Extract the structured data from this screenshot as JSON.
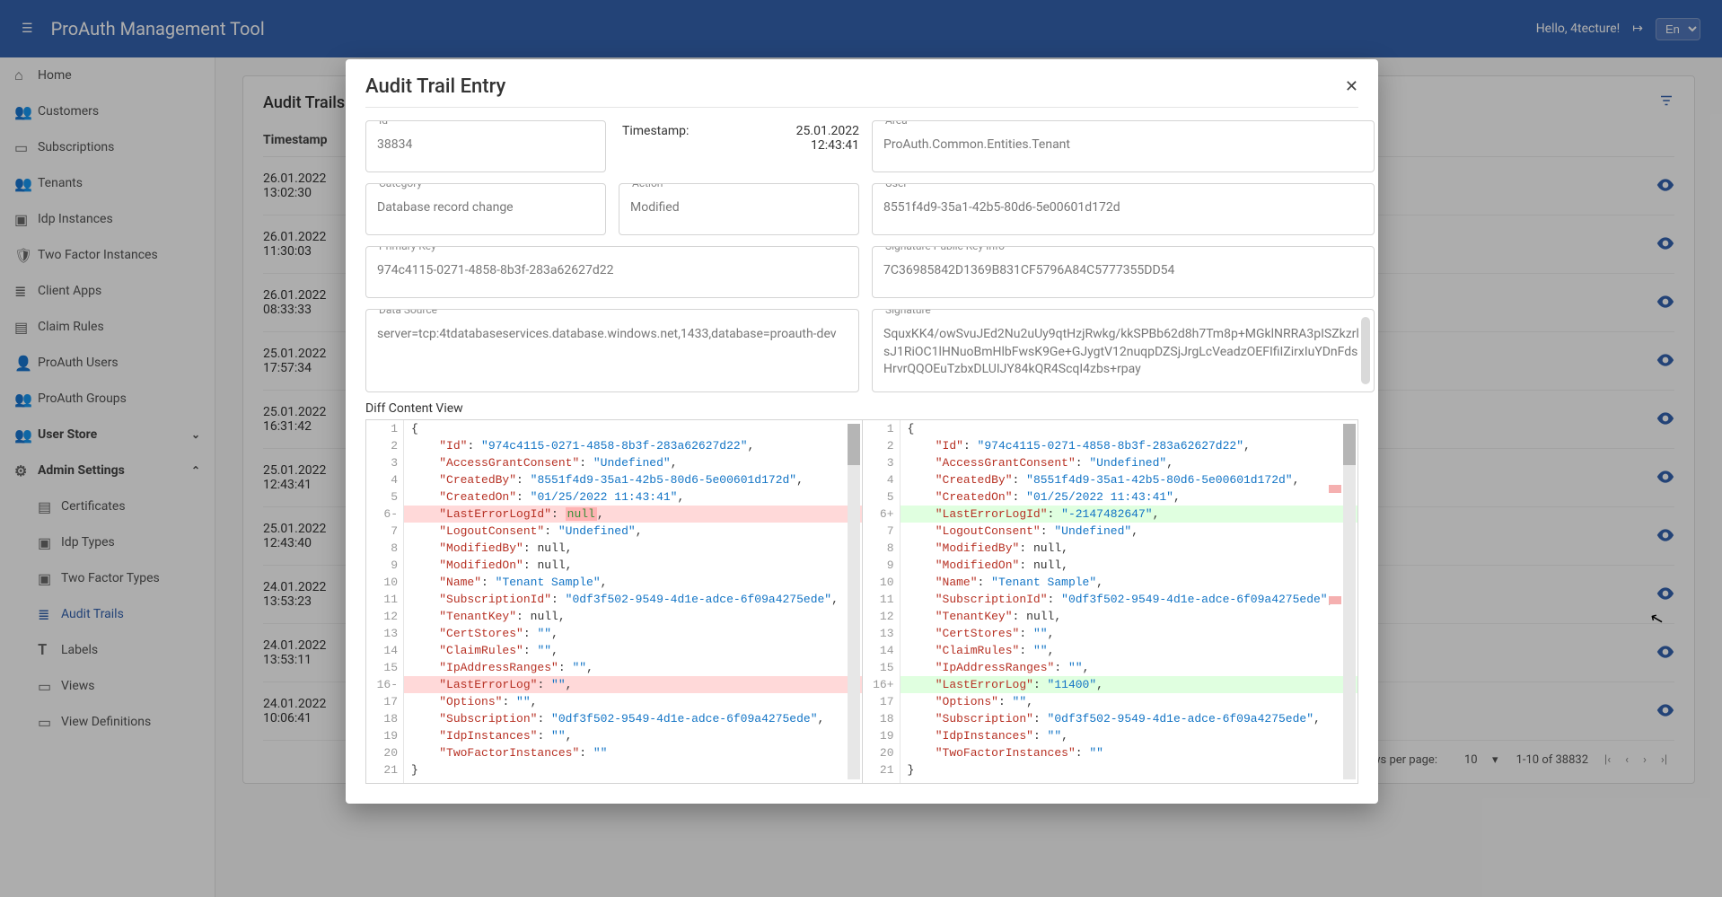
{
  "header": {
    "title": "ProAuth Management Tool",
    "greeting": "Hello, 4tecture!",
    "lang": "En"
  },
  "sidebar": {
    "items": [
      {
        "label": "Home"
      },
      {
        "label": "Customers"
      },
      {
        "label": "Subscriptions"
      },
      {
        "label": "Tenants"
      },
      {
        "label": "Idp Instances"
      },
      {
        "label": "Two Factor Instances"
      },
      {
        "label": "Client Apps"
      },
      {
        "label": "Claim Rules"
      },
      {
        "label": "ProAuth Users"
      },
      {
        "label": "ProAuth Groups"
      }
    ],
    "userstore_label": "User Store",
    "admin_label": "Admin Settings",
    "admin_items": [
      {
        "label": "Certificates"
      },
      {
        "label": "Idp Types"
      },
      {
        "label": "Two Factor Types"
      },
      {
        "label": "Audit Trails",
        "active": true
      },
      {
        "label": "Labels"
      },
      {
        "label": "Views"
      },
      {
        "label": "View Definitions"
      }
    ]
  },
  "page": {
    "title": "Audit Trails",
    "th_timestamp": "Timestamp",
    "rows": [
      {
        "date": "26.01.2022",
        "time": "13:02:30"
      },
      {
        "date": "26.01.2022",
        "time": "11:30:03"
      },
      {
        "date": "26.01.2022",
        "time": "08:33:33"
      },
      {
        "date": "25.01.2022",
        "time": "17:57:34"
      },
      {
        "date": "25.01.2022",
        "time": "16:31:42"
      },
      {
        "date": "25.01.2022",
        "time": "12:43:41"
      },
      {
        "date": "25.01.2022",
        "time": "12:43:40"
      },
      {
        "date": "24.01.2022",
        "time": "13:53:23"
      },
      {
        "date": "24.01.2022",
        "time": "13:53:11"
      },
      {
        "date": "24.01.2022",
        "time": "10:06:41"
      }
    ],
    "pager": {
      "rpp_label": "Rows per page:",
      "rpp_value": "10",
      "range": "1-10 of 38832"
    }
  },
  "modal": {
    "title": "Audit Trail Entry",
    "fields": {
      "id": {
        "label": "Id",
        "value": "38834"
      },
      "timestamp": {
        "label": "Timestamp:",
        "date": "25.01.2022",
        "time": "12:43:41"
      },
      "area": {
        "label": "Area",
        "value": "ProAuth.Common.Entities.Tenant"
      },
      "category": {
        "label": "Category",
        "value": "Database record change"
      },
      "action": {
        "label": "Action",
        "value": "Modified"
      },
      "user": {
        "label": "User",
        "value": "8551f4d9-35a1-42b5-80d6-5e00601d172d"
      },
      "pkey": {
        "label": "Primary Key",
        "value": "974c4115-0271-4858-8b3f-283a62627d22"
      },
      "spki": {
        "label": "Signature Public Key Info",
        "value": "7C36985842D1369B831CF5796A84C5777355DD54"
      },
      "datasource": {
        "label": "Data Source",
        "value": "server=tcp:4tdatabaseservices.database.windows.net,1433,database=proauth-dev"
      },
      "signature": {
        "label": "Signature",
        "value": "SquxKK4/owSvuJEd2Nu2uUy9qtHzjRwkg/kkSPBb62d8h7Tm8p+MGklNRRA3pISZkzrlsJ1RiOC1lHNuoBmHlbFwsK9Ge+GJygtV12nuqpDZSjJrgLcVeadzOEFIfiIZirxIuYDnFdsHrvrQQOEuTzbxDLUIJY84kQR4ScqI4zbs+rpay"
      }
    },
    "diff_label": "Diff Content View",
    "diff": {
      "left": [
        {
          "n": 1,
          "txt": "{"
        },
        {
          "n": 2,
          "key": "Id",
          "str": "974c4115-0271-4858-8b3f-283a62627d22",
          "c": true
        },
        {
          "n": 3,
          "key": "AccessGrantConsent",
          "str": "Undefined",
          "c": true
        },
        {
          "n": 4,
          "key": "CreatedBy",
          "str": "8551f4d9-35a1-42b5-80d6-5e00601d172d",
          "c": true
        },
        {
          "n": 5,
          "key": "CreatedOn",
          "str": "01/25/2022 11:43:41",
          "c": true
        },
        {
          "n": "6-",
          "mark": "del",
          "key": "LastErrorLogId",
          "null": true,
          "c": true
        },
        {
          "n": 7,
          "key": "LogoutConsent",
          "str": "Undefined",
          "c": true
        },
        {
          "n": 8,
          "key": "ModifiedBy",
          "raw": "null",
          "c": true
        },
        {
          "n": 9,
          "key": "ModifiedOn",
          "raw": "null",
          "c": true
        },
        {
          "n": 10,
          "key": "Name",
          "str": "Tenant Sample",
          "c": true
        },
        {
          "n": 11,
          "key": "SubscriptionId",
          "str": "0df3f502-9549-4d1e-adce-6f09a4275ede",
          "c": true
        },
        {
          "n": 12,
          "key": "TenantKey",
          "raw": "null",
          "c": true
        },
        {
          "n": 13,
          "key": "CertStores",
          "str": "",
          "c": true
        },
        {
          "n": 14,
          "key": "ClaimRules",
          "str": "",
          "c": true
        },
        {
          "n": 15,
          "key": "IpAddressRanges",
          "str": "",
          "c": true
        },
        {
          "n": "16-",
          "mark": "del",
          "key": "LastErrorLog",
          "str": "",
          "c": true
        },
        {
          "n": 17,
          "key": "Options",
          "str": "",
          "c": true
        },
        {
          "n": 18,
          "key": "Subscription",
          "str": "0df3f502-9549-4d1e-adce-6f09a4275ede",
          "c": true
        },
        {
          "n": 19,
          "key": "IdpInstances",
          "str": "",
          "c": true
        },
        {
          "n": 20,
          "key": "TwoFactorInstances",
          "str": ""
        },
        {
          "n": 21,
          "txt": "}"
        }
      ],
      "right": [
        {
          "n": 1,
          "txt": "{"
        },
        {
          "n": 2,
          "key": "Id",
          "str": "974c4115-0271-4858-8b3f-283a62627d22",
          "c": true
        },
        {
          "n": 3,
          "key": "AccessGrantConsent",
          "str": "Undefined",
          "c": true
        },
        {
          "n": 4,
          "key": "CreatedBy",
          "str": "8551f4d9-35a1-42b5-80d6-5e00601d172d",
          "c": true
        },
        {
          "n": 5,
          "key": "CreatedOn",
          "str": "01/25/2022 11:43:41",
          "c": true
        },
        {
          "n": "6+",
          "mark": "add",
          "key": "LastErrorLogId",
          "str": "-2147482647",
          "c": true
        },
        {
          "n": 7,
          "key": "LogoutConsent",
          "str": "Undefined",
          "c": true
        },
        {
          "n": 8,
          "key": "ModifiedBy",
          "raw": "null",
          "c": true
        },
        {
          "n": 9,
          "key": "ModifiedOn",
          "raw": "null",
          "c": true
        },
        {
          "n": 10,
          "key": "Name",
          "str": "Tenant Sample",
          "c": true
        },
        {
          "n": 11,
          "key": "SubscriptionId",
          "str": "0df3f502-9549-4d1e-adce-6f09a4275ede",
          "c": true
        },
        {
          "n": 12,
          "key": "TenantKey",
          "raw": "null",
          "c": true
        },
        {
          "n": 13,
          "key": "CertStores",
          "str": "",
          "c": true
        },
        {
          "n": 14,
          "key": "ClaimRules",
          "str": "",
          "c": true
        },
        {
          "n": 15,
          "key": "IpAddressRanges",
          "str": "",
          "c": true
        },
        {
          "n": "16+",
          "mark": "add",
          "key": "LastErrorLog",
          "str": "11400",
          "c": true
        },
        {
          "n": 17,
          "key": "Options",
          "str": "",
          "c": true
        },
        {
          "n": 18,
          "key": "Subscription",
          "str": "0df3f502-9549-4d1e-adce-6f09a4275ede",
          "c": true
        },
        {
          "n": 19,
          "key": "IdpInstances",
          "str": "",
          "c": true
        },
        {
          "n": 20,
          "key": "TwoFactorInstances",
          "str": ""
        },
        {
          "n": 21,
          "txt": "}"
        }
      ]
    }
  }
}
